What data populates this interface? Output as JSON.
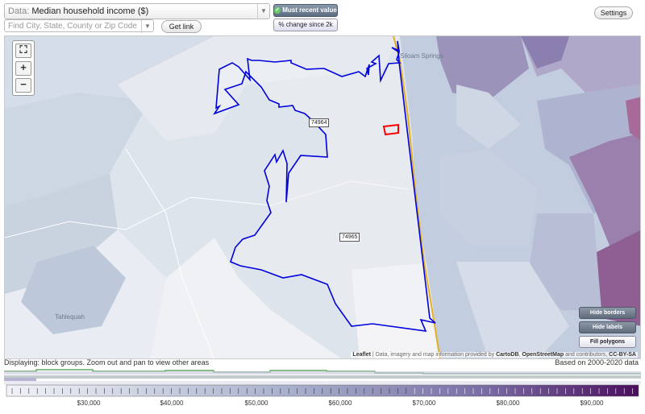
{
  "toolbar": {
    "data_label": "Data:",
    "data_value": "Median household income ($)",
    "search_placeholder": "Find City, State, County or Zip Code",
    "get_link": "Get link",
    "most_recent": "Must recent value",
    "pct_change": "% change since 2k",
    "settings": "Settings"
  },
  "map": {
    "zoom_in": "+",
    "zoom_out": "−",
    "zip_labels": [
      "74964",
      "74965"
    ],
    "places": [
      "Tahlequah",
      "Siloam Springs"
    ],
    "buttons": {
      "hide_borders": "Hide borders",
      "hide_labels": "Hide labels",
      "fill_polygons": "Fill polygons"
    },
    "attribution": {
      "leaflet": "Leaflet",
      "sep": " | Data, imagery and map information provided by ",
      "cartodb": "CartoDB",
      "sep2": ", ",
      "osm": "OpenStreetMap",
      "rest": " and contributors, ",
      "license": "CC-BY-SA"
    }
  },
  "footer": {
    "display_note": "Displaying: block groups. Zoom out and pan to view other areas",
    "based_on": "Based on 2000-2020 data"
  },
  "legend_scale": {
    "labels": [
      "$30,000",
      "$40,000",
      "$50,000",
      "$60,000",
      "$70,000",
      "$80,000",
      "$90,000"
    ],
    "min": 22000,
    "max": 97000,
    "low_color": "#f2f3f8",
    "high_color": "#4a0d5c"
  },
  "colors": {
    "boundary": "#0000dd",
    "highlight": "#ff0000",
    "road": "#e0b020"
  }
}
